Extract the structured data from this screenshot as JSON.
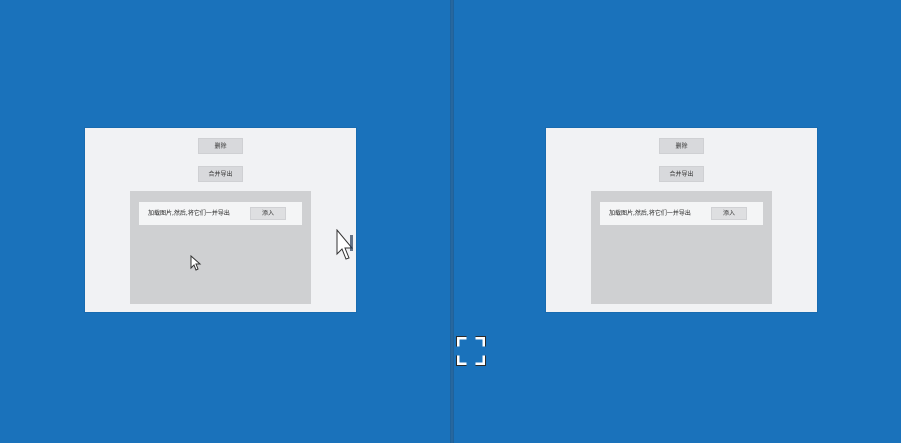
{
  "left_window": {
    "top_button": "删除",
    "second_button": "合并导出",
    "row": {
      "text": "加载图片,然后,将它们一并导出",
      "button": "添入"
    }
  },
  "right_window": {
    "top_button": "删除",
    "second_button": "合并导出",
    "row": {
      "text": "加载图片,然后,将它们一并导出",
      "button": "添入"
    }
  },
  "colors": {
    "desktop": "#1b73bb",
    "window": "#f1f2f4",
    "panel": "#cfd0d2"
  },
  "icons": {
    "fullscreen": "fullscreen-icon",
    "cursor": "mouse-pointer-icon"
  }
}
